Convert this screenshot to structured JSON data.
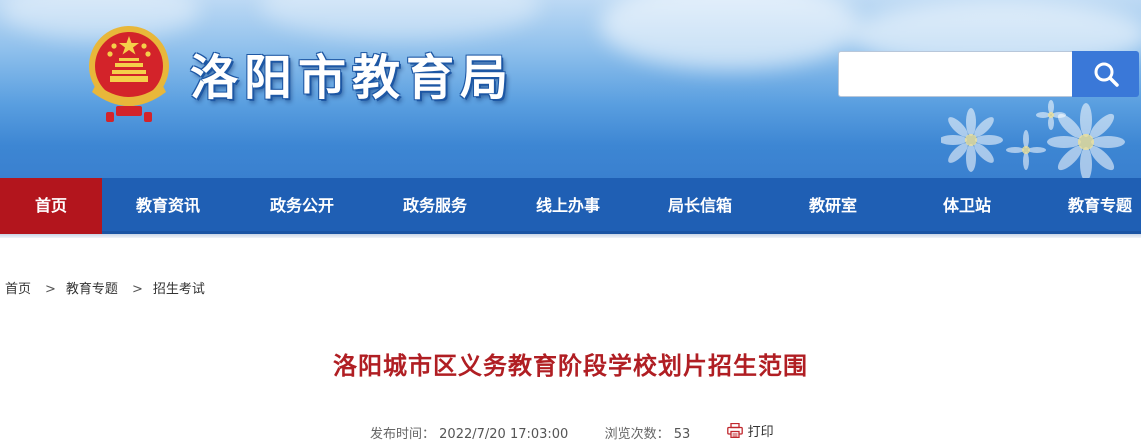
{
  "header": {
    "site_title": "洛阳市教育局",
    "search": {
      "value": ""
    }
  },
  "nav": {
    "items": [
      {
        "label": "首页",
        "active": true
      },
      {
        "label": "教育资讯"
      },
      {
        "label": "政务公开"
      },
      {
        "label": "政务服务"
      },
      {
        "label": "线上办事"
      },
      {
        "label": "局长信箱"
      },
      {
        "label": "教研室"
      },
      {
        "label": "体卫站"
      },
      {
        "label": "教育专题"
      }
    ]
  },
  "breadcrumb": {
    "items": [
      "首页",
      "教育专题",
      "招生考试"
    ],
    "separator": ">"
  },
  "article": {
    "title": "洛阳城市区义务教育阶段学校划片招生范围",
    "publish_label": "发布时间：",
    "publish_time": "2022/7/20 17:03:00",
    "views_label": "浏览次数：",
    "views": "53",
    "print_label": "打印"
  },
  "colors": {
    "nav_bg": "#1f5fb4",
    "nav_active": "#b3151d",
    "title_red": "#b01e23",
    "search_btn": "#3a78d8"
  },
  "icons": [
    "national-emblem-icon",
    "search-icon",
    "printer-icon"
  ]
}
